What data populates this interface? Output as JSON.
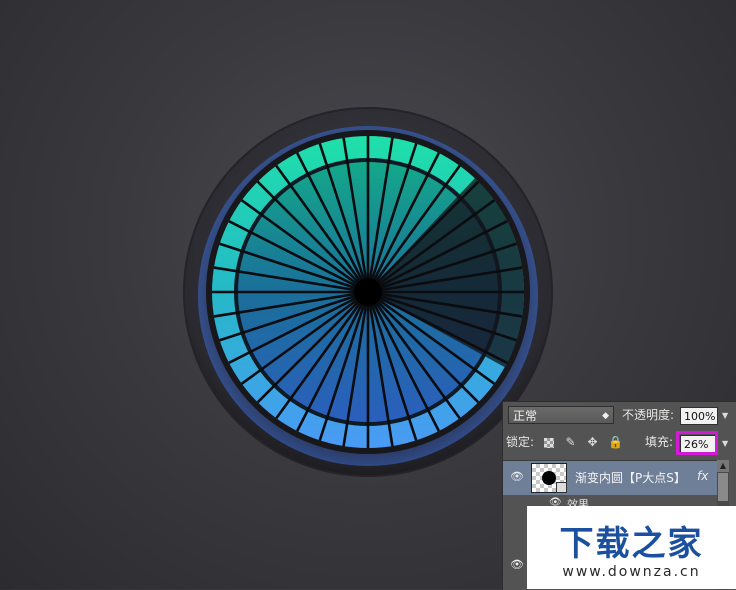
{
  "panel": {
    "blend_mode": "正常",
    "opacity_label": "不透明度:",
    "opacity_value": "100%",
    "lock_label": "锁定:",
    "fill_label": "填充:",
    "fill_value": "26%",
    "layer_name": "渐变内圆【P大点S】",
    "fx_label": "fx",
    "effects_label": "效果",
    "highlight_color": "#d21bd6"
  },
  "dial": {
    "segments": 40,
    "progress": 0.12,
    "colors": {
      "teal": "#1fd9a8",
      "blue": "#3f8ef0",
      "inactive": "#1e2128"
    }
  },
  "watermark": {
    "main": "下载之家",
    "sub": "www.downza.cn",
    "color": "#1b4fa0"
  }
}
